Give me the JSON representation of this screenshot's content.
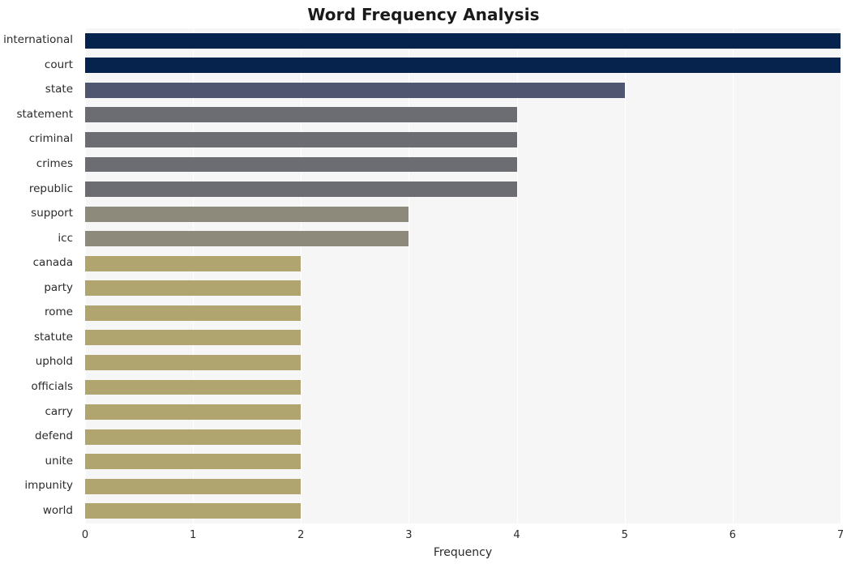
{
  "chart_data": {
    "type": "bar",
    "orientation": "horizontal",
    "title": "Word Frequency Analysis",
    "xlabel": "Frequency",
    "ylabel": "",
    "xlim": [
      0,
      7
    ],
    "xticks": [
      0,
      1,
      2,
      3,
      4,
      5,
      6,
      7
    ],
    "xtick_labels": [
      "0",
      "1",
      "2",
      "3",
      "4",
      "5",
      "6",
      "7"
    ],
    "grid": true,
    "grid_axis": "x",
    "legend": false,
    "categories": [
      "international",
      "court",
      "state",
      "statement",
      "criminal",
      "crimes",
      "republic",
      "support",
      "icc",
      "canada",
      "party",
      "rome",
      "statute",
      "uphold",
      "officials",
      "carry",
      "defend",
      "unite",
      "impunity",
      "world"
    ],
    "values": [
      7,
      7,
      5,
      4,
      4,
      4,
      4,
      3,
      3,
      2,
      2,
      2,
      2,
      2,
      2,
      2,
      2,
      2,
      2,
      2
    ],
    "bar_colors": [
      "#05234d",
      "#05234d",
      "#4e5670",
      "#6b6d72",
      "#6b6d72",
      "#6b6d72",
      "#6b6d72",
      "#8d8a7b",
      "#8d8a7b",
      "#b0a56e",
      "#b0a56e",
      "#b0a56e",
      "#b0a56e",
      "#b0a56e",
      "#b0a56e",
      "#b0a56e",
      "#b0a56e",
      "#b0a56e",
      "#b0a56e",
      "#b0a56e"
    ],
    "palette": {
      "freq_7": "#05234d",
      "freq_5": "#4e5670",
      "freq_4": "#6b6d72",
      "freq_3": "#8d8a7b",
      "freq_2": "#b0a56e"
    },
    "style": {
      "plot_background": "#f6f6f7",
      "figure_background": "#ffffff",
      "gridline_color": "#ffffff",
      "text_color": "#2b2b2b",
      "title_color": "#1a1a1a"
    }
  }
}
